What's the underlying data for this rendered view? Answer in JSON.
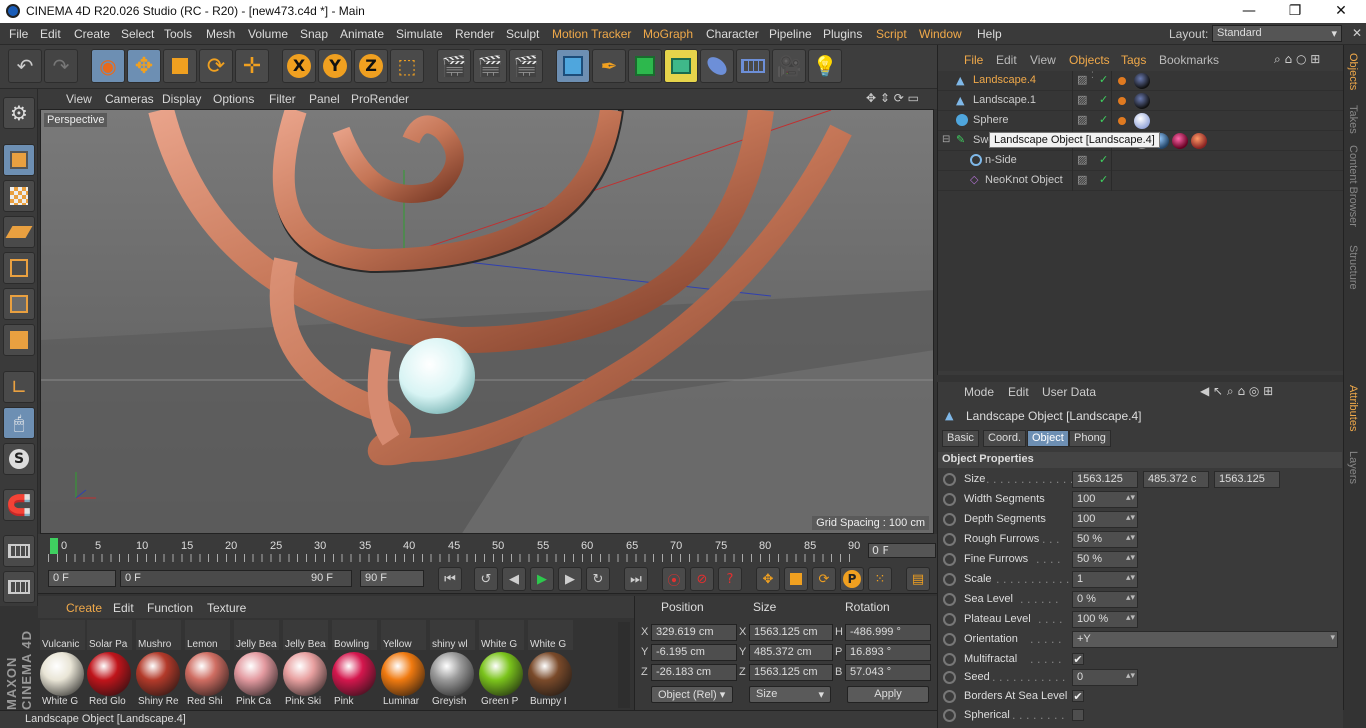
{
  "window": {
    "title": "CINEMA 4D R20.026 Studio (RC - R20) - [new473.c4d *] - Main",
    "minimize": "—",
    "maximize": "❐",
    "close": "✕"
  },
  "menubar": {
    "items": [
      "File",
      "Edit",
      "Create",
      "Select",
      "Tools",
      "Mesh",
      "Volume",
      "Snap",
      "Animate",
      "Simulate",
      "Render",
      "Sculpt",
      "Motion Tracker",
      "MoGraph",
      "Character",
      "Pipeline",
      "Plugins",
      "Script",
      "Window",
      "Help"
    ],
    "layout_label": "Layout:",
    "layout_value": "Standard"
  },
  "viewport": {
    "menu": [
      "View",
      "Cameras",
      "Display",
      "Options",
      "Filter",
      "Panel",
      "ProRender"
    ],
    "camera_label": "Perspective",
    "grid_spacing": "Grid Spacing : 100 cm"
  },
  "timeline": {
    "ticks": [
      "0",
      "5",
      "10",
      "15",
      "20",
      "25",
      "30",
      "35",
      "40",
      "45",
      "50",
      "55",
      "60",
      "65",
      "70",
      "75",
      "80",
      "85",
      "90"
    ],
    "current_frame": "0 F"
  },
  "transport": {
    "start_frame": "0 F",
    "range_start": "0 F",
    "range_end": "90 F",
    "end_frame": "90 F",
    "record_letter": "P"
  },
  "materials": {
    "menu": [
      "Create",
      "Edit",
      "Function",
      "Texture"
    ],
    "row1": [
      "Vulcanic",
      "Solar Pa",
      "Mushro",
      "Lemon",
      "Jelly Bea",
      "Jelly Bea",
      "Bowling",
      "Yellow",
      "shiny wl",
      "White G",
      "White G"
    ],
    "row2": [
      {
        "label": "White G",
        "color": "#e9e5d6"
      },
      {
        "label": "Red Glo",
        "color": "#c0141b"
      },
      {
        "label": "Shiny Re",
        "color": "#b33a2a"
      },
      {
        "label": "Red Shi",
        "color": "#cf6d62"
      },
      {
        "label": "Pink Ca",
        "color": "#e39aa0"
      },
      {
        "label": "Pink Ski",
        "color": "#e8a0a0"
      },
      {
        "label": "Pink",
        "color": "#d4164d"
      },
      {
        "label": "Luminar",
        "color": "#f07a10"
      },
      {
        "label": "Greyish",
        "color": "#9a9a9a"
      },
      {
        "label": "Green P",
        "color": "#7bc41c"
      },
      {
        "label": "Bumpy I",
        "color": "#7a4a2a"
      }
    ]
  },
  "coords": {
    "headers": [
      "Position",
      "Size",
      "Rotation"
    ],
    "rows": [
      {
        "axis": "X",
        "pos": "329.619 cm",
        "saxis": "X",
        "size": "1563.125 cm",
        "raxis": "H",
        "rot": "-486.999 °"
      },
      {
        "axis": "Y",
        "pos": "-6.195 cm",
        "saxis": "Y",
        "size": "485.372 cm",
        "raxis": "P",
        "rot": "16.893 °"
      },
      {
        "axis": "Z",
        "pos": "-26.183 cm",
        "saxis": "Z",
        "size": "1563.125 cm",
        "raxis": "B",
        "rot": "57.043 °"
      }
    ],
    "mode_select": "Object (Rel)",
    "size_select": "Size",
    "apply": "Apply"
  },
  "status": "Landscape Object [Landscape.4]",
  "objects": {
    "menu": [
      "File",
      "Edit",
      "View",
      "Objects",
      "Tags",
      "Bookmarks"
    ],
    "items": [
      {
        "name": "Landscape.4",
        "selected": true
      },
      {
        "name": "Landscape.1",
        "selected": false
      },
      {
        "name": "Sphere",
        "selected": false
      },
      {
        "name": "Sweep",
        "selected": false
      },
      {
        "name": "n-Side",
        "selected": false
      },
      {
        "name": "NeoKnot Object",
        "selected": false
      }
    ],
    "tooltip": "Landscape Object [Landscape.4]"
  },
  "righttabs": [
    "Objects",
    "Takes",
    "Content Browser",
    "Structure",
    "Attributes",
    "Layers"
  ],
  "attributes": {
    "menu": [
      "Mode",
      "Edit",
      "User Data"
    ],
    "title": "Landscape Object [Landscape.4]",
    "tabs": [
      "Basic",
      "Coord.",
      "Object",
      "Phong"
    ],
    "section": "Object Properties",
    "props": {
      "size_label": "Size",
      "size_x": "1563.125",
      "size_y": "485.372 c",
      "size_z": "1563.125",
      "width_label": "Width Segments",
      "width": "100",
      "depth_label": "Depth Segments",
      "depth": "100",
      "rough_label": "Rough Furrows",
      "rough": "50 %",
      "fine_label": "Fine Furrows",
      "fine": "50 %",
      "scale_label": "Scale",
      "scale": "1",
      "sea_label": "Sea Level",
      "sea": "0 %",
      "plateau_label": "Plateau Level",
      "plateau": "100 %",
      "orient_label": "Orientation",
      "orient": "+Y",
      "multi_label": "Multifractal",
      "multi": "✔",
      "seed_label": "Seed",
      "seed": "0",
      "borders_label": "Borders At Sea Level",
      "borders": "✔",
      "spherical_label": "Spherical",
      "spherical": ""
    }
  }
}
